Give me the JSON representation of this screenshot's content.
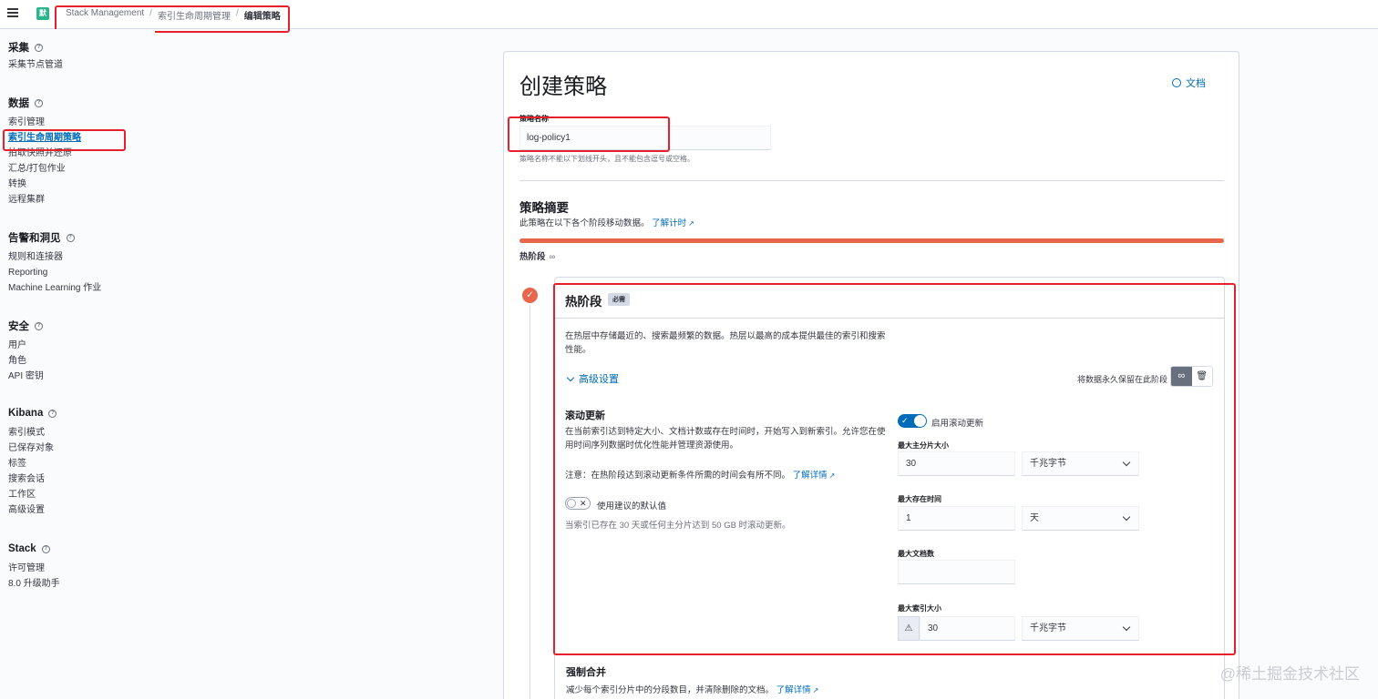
{
  "header": {
    "avatar": "默",
    "breadcrumbs": [
      "Stack Management",
      "索引生命周期管理",
      "编辑策略"
    ]
  },
  "sidebar": {
    "groups": [
      {
        "title": "采集",
        "items": [
          "采集节点管道"
        ]
      },
      {
        "title": "数据",
        "items": [
          "索引管理",
          "索引生命周期策略",
          "拍取快照并还原",
          "汇总/打包作业",
          "转换",
          "远程集群"
        ]
      },
      {
        "title": "告警和洞见",
        "items": [
          "规则和连接器",
          "Reporting",
          "Machine Learning 作业"
        ]
      },
      {
        "title": "安全",
        "items": [
          "用户",
          "角色",
          "API 密钥"
        ]
      },
      {
        "title": "Kibana",
        "items": [
          "索引模式",
          "已保存对象",
          "标签",
          "搜索会话",
          "工作区",
          "高级设置"
        ]
      },
      {
        "title": "Stack",
        "items": [
          "许可管理",
          "8.0 升级助手"
        ]
      }
    ],
    "active_item": "索引生命周期策略"
  },
  "main": {
    "title": "创建策略",
    "doc_link": "文档",
    "policy_name_label": "策略名称",
    "policy_name_value": "log-policy1",
    "policy_name_help": "策略名称不能以下划线开头，且不能包含逗号或空格。",
    "summary_title": "策略摘要",
    "summary_desc": "此策略在以下各个阶段移动数据。",
    "summary_link": "了解计时",
    "phase_bar_label": "热阶段",
    "phase_bar_icon": "∞"
  },
  "hot_phase": {
    "title": "热阶段",
    "badge": "必需",
    "description": "在热层中存储最近的、搜索最频繁的数据。热层以最高的成本提供最佳的索引和搜索性能。",
    "advanced_toggle": "高级设置",
    "keep_forever_label": "将数据永久保留在此阶段",
    "keep_forever_icon": "∞",
    "trash_icon": "🗑",
    "rollover": {
      "title": "滚动更新",
      "description": "在当前索引达到特定大小、文档计数或存在时间时，开始写入到新索引。允许您在使用时间序列数据时优化性能并管理资源使用。",
      "note": "注意：在热阶段达到滚动更新条件所需的时间会有所不同。",
      "note_link": "了解详情",
      "default_switch_label": "使用建议的默认值",
      "default_switch_help": "当索引已存在 30 天或任何主分片达到 50 GB 时滚动更新。",
      "enable_label": "启用滚动更新",
      "max_shard_size_label": "最大主分片大小",
      "max_shard_size_value": "30",
      "max_shard_size_unit": "千兆字节",
      "max_age_label": "最大存在时间",
      "max_age_value": "1",
      "max_age_unit": "天",
      "max_docs_label": "最大文档数",
      "max_docs_value": "",
      "max_index_size_label": "最大索引大小",
      "max_index_size_value": "30",
      "max_index_size_unit": "千兆字节",
      "warning_icon": "⚠"
    },
    "forcemerge": {
      "title": "强制合并",
      "description": "减少每个索引分片中的分段数目，并清除删除的文档。",
      "link": "了解详情"
    }
  },
  "watermark": "@稀土掘金技术社区"
}
